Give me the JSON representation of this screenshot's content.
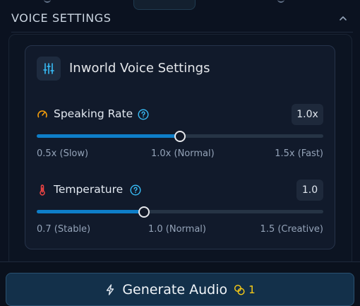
{
  "section": {
    "title": "Voice Settings"
  },
  "card": {
    "title": "Inworld Voice Settings",
    "icon": "sliders-icon"
  },
  "speaking_rate": {
    "label": "Speaking Rate",
    "icon": "gauge-icon",
    "value_display": "1.0x",
    "slider_fraction": 0.5,
    "min_label": "0.5x (Slow)",
    "mid_label": "1.0x (Normal)",
    "max_label": "1.5x (Fast)"
  },
  "temperature": {
    "label": "Temperature",
    "icon": "thermometer-icon",
    "value_display": "1.0",
    "slider_fraction": 0.375,
    "min_label": "0.7 (Stable)",
    "mid_label": "1.0 (Normal)",
    "max_label": "1.5 (Creative)"
  },
  "generate": {
    "label": "Generate Audio",
    "credits": "1",
    "icon": "lightning-icon",
    "credit_icon": "coins-icon"
  },
  "colors": {
    "accent": "#0e7ec8",
    "gauge": "#f59e0b",
    "thermometer": "#ef4444",
    "credit": "#facc15",
    "help": "#38bdf8"
  }
}
